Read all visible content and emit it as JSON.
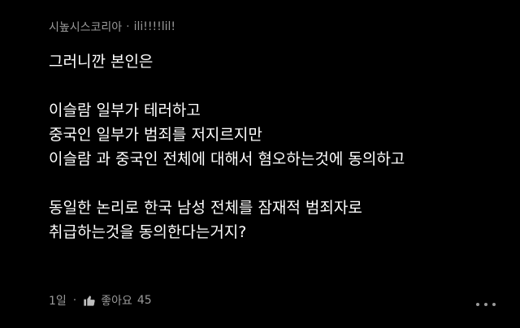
{
  "comment": {
    "author": "시높시스코리아",
    "separator": "·",
    "user_id": "ili!!!!lil!",
    "lines": [
      "그러니깐 본인은",
      "",
      "이슬람 일부가 테러하고",
      "중국인 일부가 범죄를 저지르지만",
      "이슬람 과 중국인 전체에 대해서 혐오하는것에 동의하고",
      "",
      "동일한 논리로 한국 남성 전체를 잠재적 범죄자로",
      "취급하는것을 동의한다는거지?"
    ],
    "time": "1일",
    "like_label": "좋아요",
    "like_count": "45",
    "icons": {
      "like": "thumbs-up-icon",
      "more": "more-options-icon"
    }
  },
  "colors": {
    "background": "#000000",
    "text": "#ffffff",
    "meta": "#9a9a9a"
  }
}
